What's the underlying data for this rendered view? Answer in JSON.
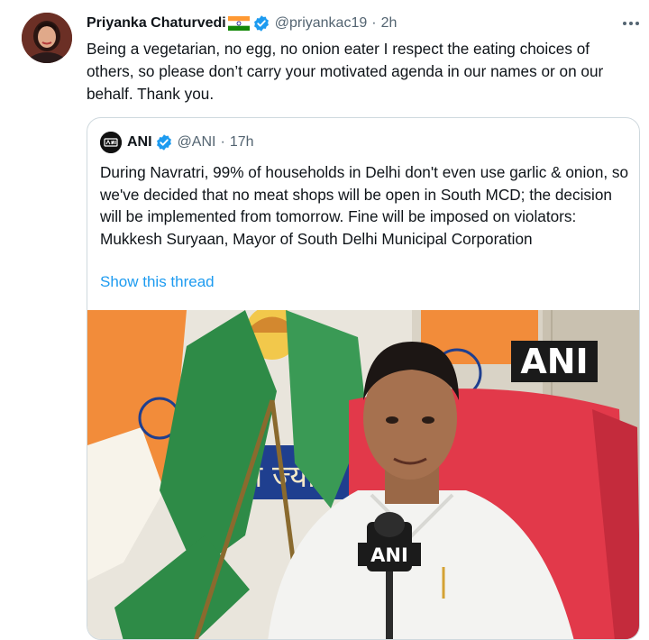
{
  "tweet": {
    "author_name": "Priyanka Chaturvedi",
    "handle": "@priyankac19",
    "separator": "·",
    "time": "2h",
    "flag_icon": "india-flag-icon",
    "more_icon": "more-horizontal-icon",
    "text": "Being a vegetarian, no egg, no onion eater I respect the eating choices of others, so please don’t carry your motivated agenda in our names or on our behalf. Thank you."
  },
  "quoted": {
    "author_name": "ANI",
    "handle": "@ANI",
    "separator": "·",
    "time": "17h",
    "text": "During Navratri, 99% of households in Delhi don't even use garlic & onion, so we've decided that no meat shops will be open in South MCD; the decision will be implemented from tomorrow. Fine will be imposed on violators: Mukkesh Suryaan, Mayor of South Delhi Municipal Corporation",
    "show_thread": "Show this thread",
    "watermark": "ANI",
    "mic_label": "ANI"
  },
  "colors": {
    "accent": "#1d9bf0",
    "text": "#0f1419",
    "secondary": "#536471",
    "border": "#cfd9de"
  }
}
